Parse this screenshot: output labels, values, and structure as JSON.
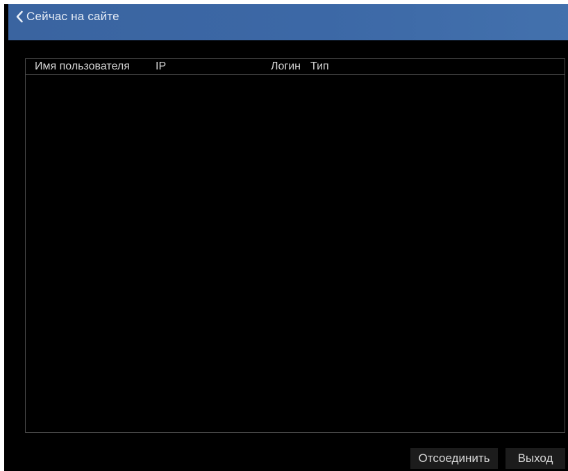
{
  "header": {
    "title": "Сейчас на сайте"
  },
  "table": {
    "columns": [
      "Имя пользователя",
      "IP",
      "Логин",
      "Тип"
    ],
    "rows": []
  },
  "buttons": {
    "disconnect": "Отсоединить",
    "exit": "Выход"
  },
  "colors": {
    "titlebar": "#3c68a6",
    "background": "#000000",
    "button": "#1c1c1c"
  }
}
